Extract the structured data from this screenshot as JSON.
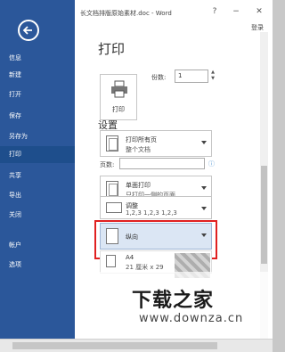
{
  "titlebar": {
    "title": "长文档排版原始素材.doc - Word",
    "help": "?",
    "minimize": "−",
    "close": "✕",
    "login": "登录"
  },
  "sidebar": {
    "items": [
      {
        "label": "信息"
      },
      {
        "label": "新建"
      },
      {
        "label": "打开"
      },
      {
        "label": "保存"
      },
      {
        "label": "另存为"
      },
      {
        "label": "打印"
      },
      {
        "label": "共享"
      },
      {
        "label": "导出"
      },
      {
        "label": "关闭"
      },
      {
        "label": "帐户"
      },
      {
        "label": "选项"
      }
    ],
    "active": "打印"
  },
  "main": {
    "heading": "打印",
    "print_button": "打印",
    "copies_label": "份数:",
    "copies_value": "1",
    "settings_heading": "设置",
    "print_range": {
      "line1": "打印所有页",
      "line2": "整个文档"
    },
    "pages_label": "页数:",
    "pages_placeholder": "",
    "info_icon": "ⓘ",
    "sides": {
      "line1": "单面打印",
      "line2": "只打印一侧的页面"
    },
    "collate": {
      "line1": "调整",
      "line2": "1,2,3    1,2,3    1,2,3"
    },
    "orientation": {
      "line1": "纵向",
      "line2": ""
    },
    "paper": {
      "line1": "A4",
      "line2": "21 厘米 x 29"
    }
  },
  "watermark": {
    "logo": "下载之家",
    "url": "www.downza.cn"
  },
  "colors": {
    "sidebar": "#2b579a",
    "highlight": "#dbe6f4",
    "annotation": "#e02020"
  }
}
